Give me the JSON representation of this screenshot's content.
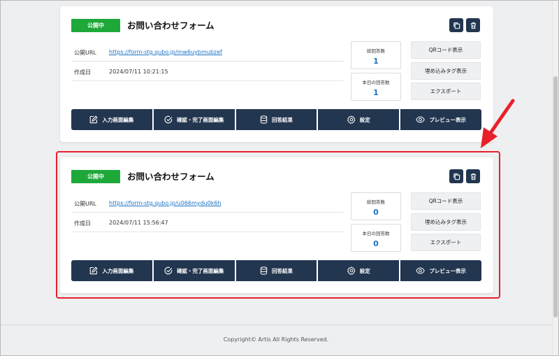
{
  "cards": [
    {
      "status": "公開中",
      "title": "お問い合わせフォーム",
      "url_label": "公開URL",
      "url": "https://form-stg.qubo.jp/mw6uybmubzef",
      "created_label": "作成日",
      "created": "2024/07/11 10:21:15",
      "total_label": "総回答数",
      "total": "1",
      "today_label": "本日の回答数",
      "today": "1",
      "qr_label": "QRコード表示",
      "embed_label": "埋め込みタグ表示",
      "export_label": "エクスポート",
      "actions": [
        "入力画面編集",
        "確認・完了画面編集",
        "回答結果",
        "設定",
        "プレビュー表示"
      ]
    },
    {
      "status": "公開中",
      "title": "お問い合わせフォーム",
      "url_label": "公開URL",
      "url": "https://form-stg.qubo.jp/u066mydu0k6h",
      "created_label": "作成日",
      "created": "2024/07/11 15:56:47",
      "total_label": "総回答数",
      "total": "0",
      "today_label": "本日の回答数",
      "today": "0",
      "qr_label": "QRコード表示",
      "embed_label": "埋め込みタグ表示",
      "export_label": "エクスポート",
      "actions": [
        "入力画面編集",
        "確認・完了画面編集",
        "回答結果",
        "設定",
        "プレビュー表示"
      ]
    }
  ],
  "footer": {
    "copyright": "Copyright© Artis All Rights Reserved."
  },
  "icons": {
    "copy": "copy-icon",
    "trash": "trash-icon",
    "edit": "edit-icon",
    "check": "check-circle-icon",
    "results": "database-icon",
    "settings": "gear-icon",
    "preview": "eye-icon"
  },
  "colors": {
    "status_green": "#1ea83a",
    "navy": "#233650",
    "link": "#1a73c7",
    "highlight": "#e8202a"
  }
}
